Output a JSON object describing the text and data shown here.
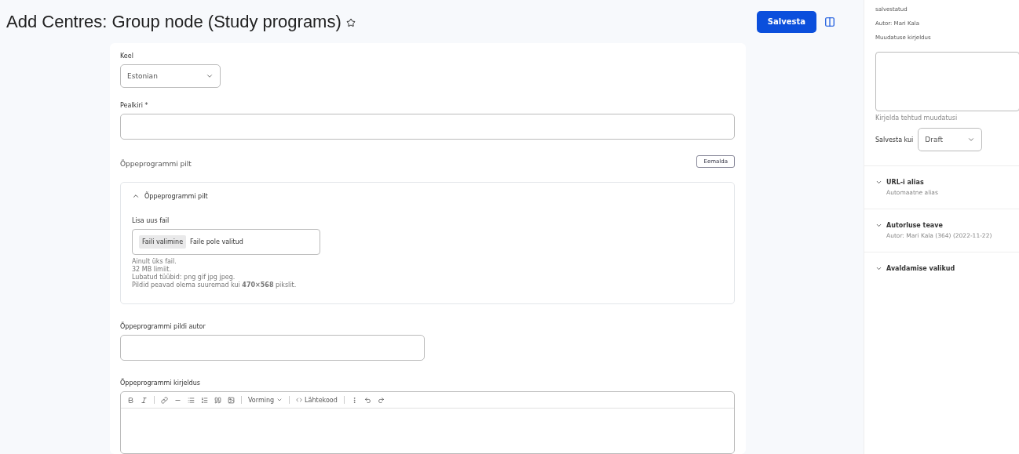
{
  "header": {
    "title": "Add Centres: Group node (Study programs)",
    "save_button": "Salvesta"
  },
  "form": {
    "language": {
      "label": "Keel",
      "value": "Estonian"
    },
    "title_field": {
      "label": "Pealkiri",
      "required_mark": "*"
    },
    "image_section": {
      "label": "Õppeprogrammi pilt",
      "button": "Eemalda"
    },
    "image_details": {
      "summary": "Õppeprogrammi pilt",
      "expanded": true,
      "add_label": "Lisa uus fail",
      "file_button": "Faili valimine",
      "file_status": "Faile pole valitud",
      "help": [
        "Ainult üks fail.",
        "32 MB limiit.",
        "Lubatud tüübid: png gif jpg jpeg.",
        "Pildid peavad olema suuremad kui **470×568** pikslit."
      ]
    },
    "image_author": {
      "label": "Õppeprogrammi pildi autor"
    },
    "description": {
      "label": "Õppeprogrammi kirjeldus",
      "format": "Vorming",
      "source": "Lähtekood"
    }
  },
  "sidebar": {
    "status": "salvestatud",
    "author": "Autor: Mari Kala",
    "log_label": "Muudatuse kirjeldus",
    "log_hint": "Kirjelda tehtud muudatusi",
    "save_as_label": "Salvesta kui",
    "save_as_value": "Draft",
    "sections": [
      {
        "title": "URL-i alias",
        "summary": "Automaatne alias",
        "expanded": false
      },
      {
        "title": "Autorluse teave",
        "summary": "Autor: Mari Kala (364) (2022-11-22)",
        "expanded": false
      },
      {
        "title": "Avaldamise valikud",
        "expanded": false
      }
    ]
  }
}
